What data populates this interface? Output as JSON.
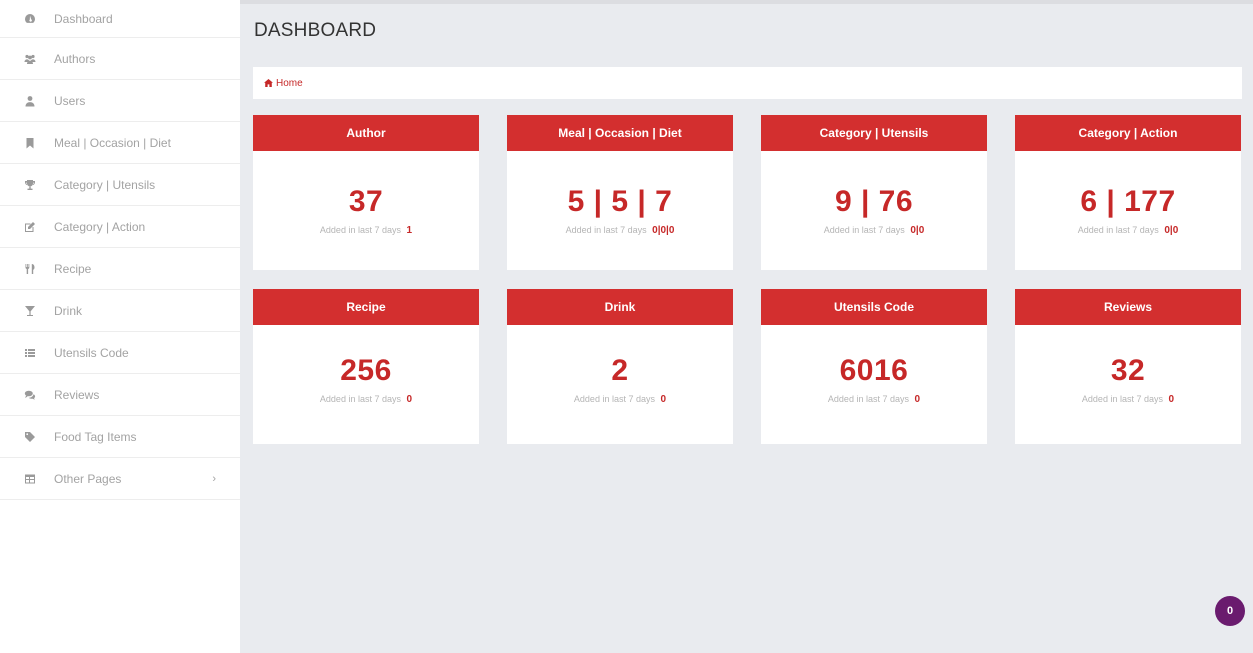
{
  "sidebar": {
    "items": [
      {
        "label": "Dashboard",
        "icon": "dashboard-icon"
      },
      {
        "label": "Authors",
        "icon": "authors-icon"
      },
      {
        "label": "Users",
        "icon": "user-icon"
      },
      {
        "label": "Meal | Occasion | Diet",
        "icon": "bookmark-icon"
      },
      {
        "label": "Category | Utensils",
        "icon": "trophy-icon"
      },
      {
        "label": "Category | Action",
        "icon": "edit-icon"
      },
      {
        "label": "Recipe",
        "icon": "cutlery-icon"
      },
      {
        "label": "Drink",
        "icon": "glass-icon"
      },
      {
        "label": "Utensils Code",
        "icon": "list-icon"
      },
      {
        "label": "Reviews",
        "icon": "comments-icon"
      },
      {
        "label": "Food Tag Items",
        "icon": "tag-icon"
      },
      {
        "label": "Other Pages",
        "icon": "table-icon",
        "chevron": "›"
      }
    ]
  },
  "header": {
    "title": "DASHBOARD"
  },
  "breadcrumb": {
    "home": "Home"
  },
  "cards": [
    {
      "title": "Author",
      "value": "37",
      "sub": "Added in last 7 days",
      "recent": "1"
    },
    {
      "title": "Meal | Occasion | Diet",
      "value": "5 | 5 | 7",
      "sub": "Added in last 7 days",
      "recent": "0|0|0"
    },
    {
      "title": "Category | Utensils",
      "value": "9 | 76",
      "sub": "Added in last 7 days",
      "recent": "0|0"
    },
    {
      "title": "Category | Action",
      "value": "6 | 177",
      "sub": "Added in last 7 days",
      "recent": "0|0"
    },
    {
      "title": "Recipe",
      "value": "256",
      "sub": "Added in last 7 days",
      "recent": "0"
    },
    {
      "title": "Drink",
      "value": "2",
      "sub": "Added in last 7 days",
      "recent": "0"
    },
    {
      "title": "Utensils Code",
      "value": "6016",
      "sub": "Added in last 7 days",
      "recent": "0"
    },
    {
      "title": "Reviews",
      "value": "32",
      "sub": "Added in last 7 days",
      "recent": "0"
    }
  ],
  "notification": {
    "count": "0"
  },
  "colors": {
    "accent": "#d32f2f",
    "value": "#c62828",
    "background": "#e9ebef",
    "badge": "#6a1b6e"
  }
}
